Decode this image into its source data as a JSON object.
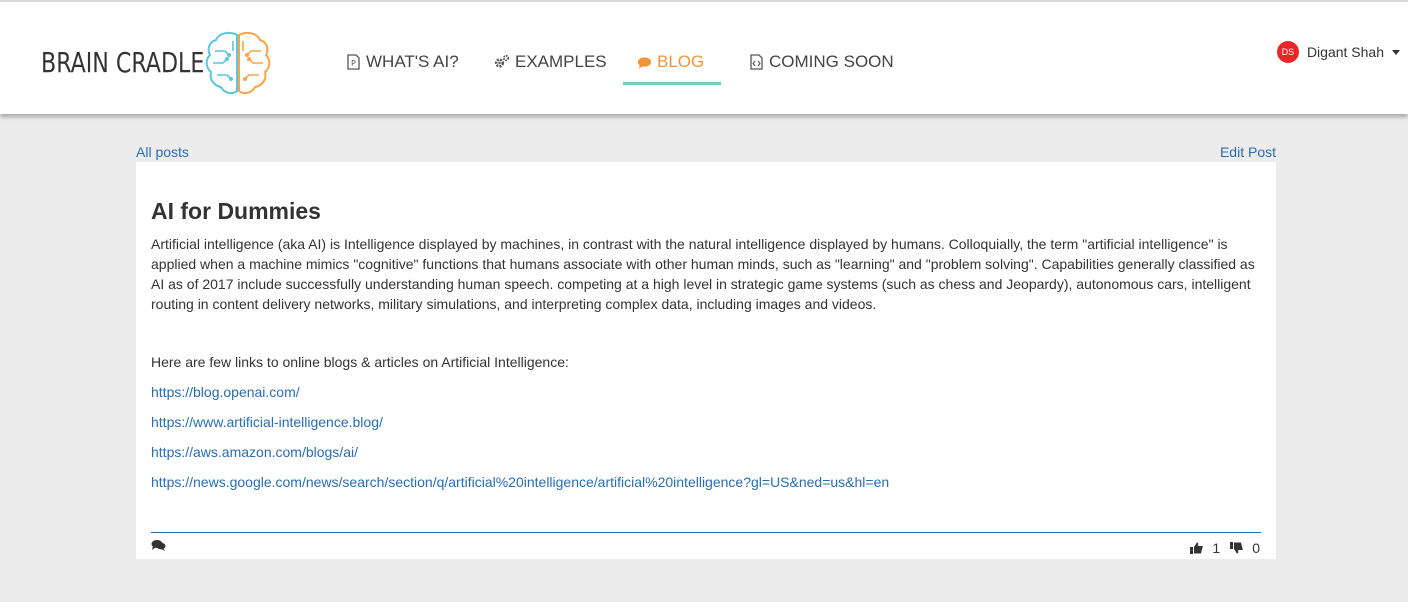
{
  "header": {
    "brand": "BRAIN CRADLE",
    "nav": [
      {
        "label": "WHAT'S AI?",
        "icon": "document-icon",
        "active": false
      },
      {
        "label": "EXAMPLES",
        "icon": "gears-icon",
        "active": false
      },
      {
        "label": "BLOG",
        "icon": "comment-icon",
        "active": true
      },
      {
        "label": "COMING SOON",
        "icon": "code-file-icon",
        "active": false
      }
    ],
    "user": {
      "initials": "DS",
      "name": "Digant Shah"
    }
  },
  "colors": {
    "accent": "#f2953a",
    "underline": "#7ccdb8",
    "link": "#2a6db0",
    "avatar": "#e8272b"
  },
  "post_nav": {
    "all_posts": "All posts",
    "edit_post": "Edit Post"
  },
  "post": {
    "title": "AI for Dummies",
    "body": "Artificial intelligence (aka AI) is Intelligence displayed by machines, in contrast with the natural intelligence displayed by humans. Colloquially, the term \"artificial intelligence\" is applied when a machine mimics \"cognitive\" functions that humans associate with other human minds, such as \"learning\" and \"problem solving\". Capabilities generally classified as AI as of 2017 include successfully understanding human speech. competing at a high level in strategic game systems (such as chess and Jeopardy), autonomous cars, intelligent routing in content delivery networks, military simulations, and interpreting complex data, including images and videos.",
    "links_intro": "Here are few links to online blogs & articles on Artificial Intelligence:",
    "links": [
      "https://blog.openai.com/",
      "https://www.artificial-intelligence.blog/",
      "https://aws.amazon.com/blogs/ai/",
      "https://news.google.com/news/search/section/q/artificial%20intelligence/artificial%20intelligence?gl=US&ned=us&hl=en"
    ],
    "likes": "1",
    "dislikes": "0"
  }
}
